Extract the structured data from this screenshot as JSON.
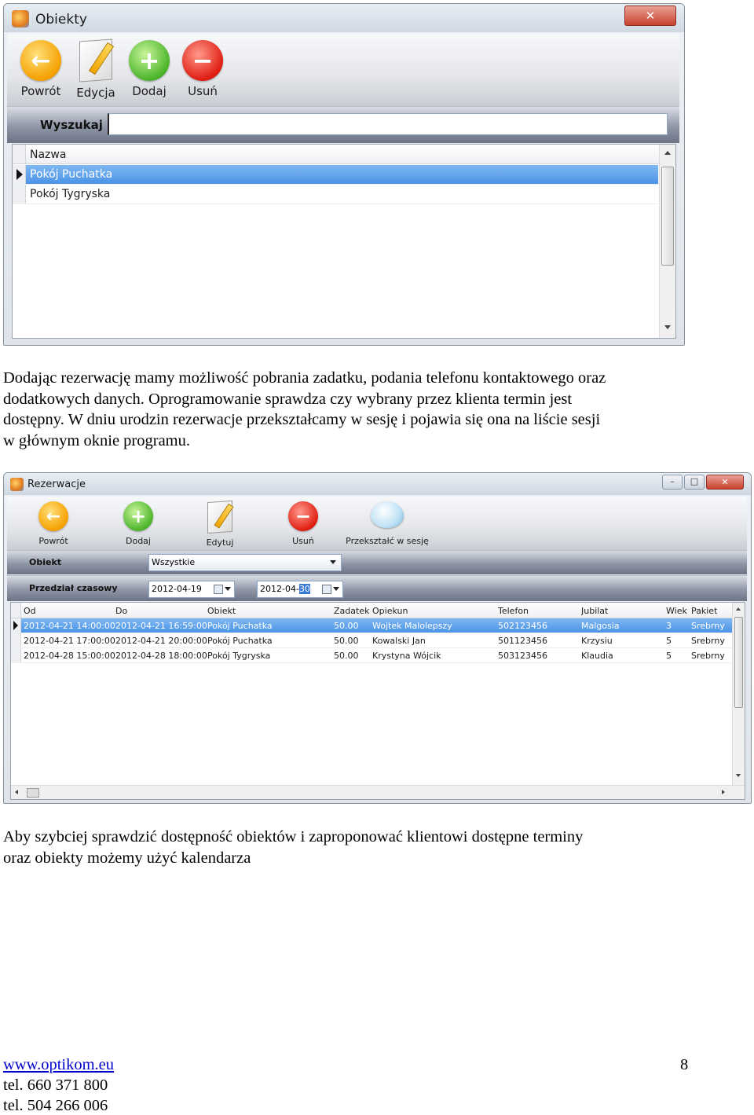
{
  "window_obiekty": {
    "title": "Obiekty",
    "close_glyph": "✕",
    "toolbar": [
      {
        "label": "Powrót",
        "icon": "back-arrow-icon"
      },
      {
        "label": "Edycja",
        "icon": "edit-pencil-icon"
      },
      {
        "label": "Dodaj",
        "icon": "add-plus-icon"
      },
      {
        "label": "Usuń",
        "icon": "remove-minus-icon"
      }
    ],
    "search": {
      "label": "Wyszukaj",
      "value": ""
    },
    "grid": {
      "header": "Nazwa",
      "rows": [
        "Pokój Puchatka",
        "Pokój Tygryska"
      ],
      "selected_row": 0
    }
  },
  "paragraph1": [
    "Dodając rezerwację mamy możliwość pobrania zadatku, podania telefonu kontaktowego oraz",
    "dodatkowych danych. Oprogramowanie sprawdza czy wybrany przez klienta termin jest",
    "dostępny. W dniu urodzin rezerwacje przekształcamy w sesję i pojawia się ona na liście sesji",
    "w głównym oknie programu."
  ],
  "window_rezerwacje": {
    "title": "Rezerwacje",
    "close_glyph": "✕",
    "maximize_glyph": "□",
    "minimize_glyph": "–",
    "toolbar": [
      {
        "label": "Powrót",
        "icon": "back-arrow-icon"
      },
      {
        "label": "Dodaj",
        "icon": "add-plus-icon"
      },
      {
        "label": "Edytuj",
        "icon": "edit-pencil-icon"
      },
      {
        "label": "Usuń",
        "icon": "remove-minus-icon"
      },
      {
        "label": "Przekształć w sesję",
        "icon": "speech-bubble-icon"
      }
    ],
    "filter_obiekt": {
      "label": "Obiekt",
      "value": "Wszystkie"
    },
    "filter_time": {
      "label": "Przedział czasowy",
      "from": "2012-04-19",
      "to_prefix": "2012-04-",
      "to_highlight": "30"
    },
    "grid": {
      "columns": [
        "Od",
        "Do",
        "Obiekt",
        "Zadatek",
        "Opiekun",
        "Telefon",
        "Jubilat",
        "Wiek",
        "Pakiet"
      ],
      "rows": [
        [
          "2012-04-21 14:00:00",
          "2012-04-21 16:59:00",
          "Pokój Puchatka",
          "50.00",
          "Wojtek Malolepszy",
          "502123456",
          "Malgosia",
          "3",
          "Srebrny"
        ],
        [
          "2012-04-21 17:00:00",
          "2012-04-21 20:00:00",
          "Pokój Puchatka",
          "50.00",
          "Kowalski Jan",
          "501123456",
          "Krzysiu",
          "5",
          "Srebrny"
        ],
        [
          "2012-04-28 15:00:00",
          "2012-04-28 18:00:00",
          "Pokój Tygryska",
          "50.00",
          "Krystyna Wójcik",
          "503123456",
          "Klaudia",
          "5",
          "Srebrny"
        ]
      ],
      "selected_row": 0
    }
  },
  "paragraph2": [
    "Aby szybciej sprawdzić dostępność obiektów i zaproponować klientowi dostępne terminy",
    "oraz obiekty możemy użyć kalendarza"
  ],
  "footer": {
    "website": "www.optikom.eu",
    "phone1": "tel. 660 371 800",
    "phone2": "tel. 504 266 006",
    "page_number": "8"
  }
}
